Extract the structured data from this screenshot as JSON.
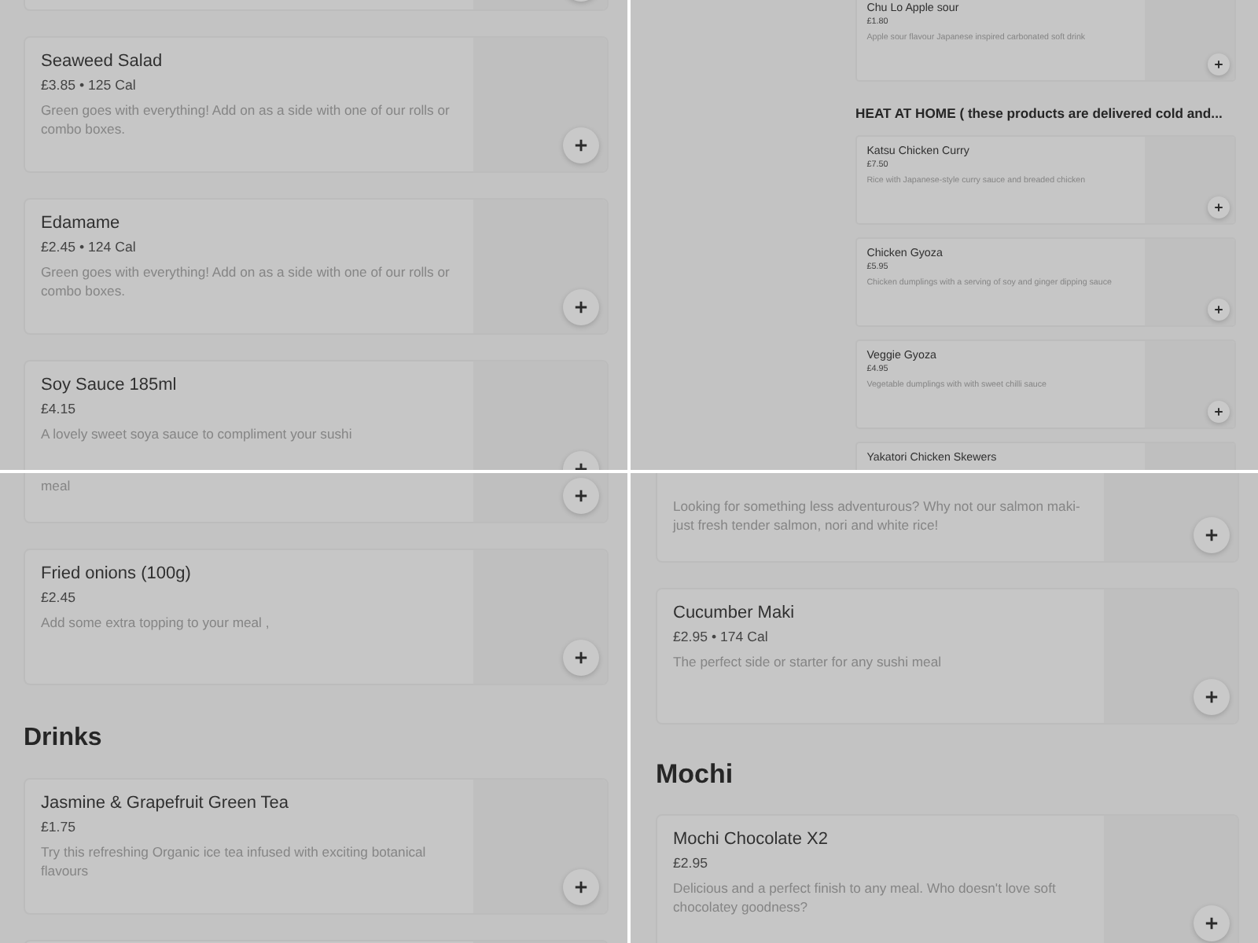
{
  "panels": [
    {
      "entries": [
        {
          "kind": "item_top"
        },
        {
          "kind": "item",
          "name": "Seaweed Salad",
          "price": "£3.85 • 125 Cal",
          "description": "Green goes with everything! Add on as a side with one of our rolls or combo boxes."
        },
        {
          "kind": "item",
          "name": "Edamame",
          "price": "£2.45 • 124 Cal",
          "description": "Green goes with everything! Add on as a side with one of our rolls or combo boxes."
        },
        {
          "kind": "item",
          "name": "Soy Sauce 185ml",
          "price": "£4.15",
          "description": "A lovely sweet soya sauce to compliment your sushi"
        }
      ]
    },
    {
      "entries": [
        {
          "kind": "item",
          "name": "Chu Lo Apple sour",
          "price": "£1.80",
          "description": "Apple sour flavour Japanese inspired carbonated soft drink"
        },
        {
          "kind": "heading",
          "title": "HEAT AT HOME ( these products are delivered cold and..."
        },
        {
          "kind": "item",
          "name": "Katsu Chicken Curry",
          "price": "£7.50",
          "description": "Rice with Japanese-style curry sauce and breaded chicken"
        },
        {
          "kind": "item",
          "name": "Chicken Gyoza",
          "price": "£5.95",
          "description": "Chicken dumplings with a serving of soy and ginger dipping sauce"
        },
        {
          "kind": "item",
          "name": "Veggie Gyoza",
          "price": "£4.95",
          "description": "Vegetable dumplings with with sweet chilli sauce"
        },
        {
          "kind": "item_cut",
          "name": "Yakatori Chicken Skewers"
        }
      ]
    },
    {
      "entries": [
        {
          "kind": "item",
          "description": "meal"
        },
        {
          "kind": "item",
          "name": "Fried onions (100g)",
          "price": "£2.45",
          "description": "Add some extra topping to your meal ,"
        },
        {
          "kind": "heading",
          "title": "Drinks"
        },
        {
          "kind": "item",
          "name": "Jasmine & Grapefruit Green Tea",
          "price": "£1.75",
          "description": "Try this refreshing Organic ice tea infused with exciting botanical flavours"
        },
        {
          "kind": "item_cut"
        }
      ]
    },
    {
      "entries": [
        {
          "kind": "item",
          "description": "Looking for something less adventurous? Why not our salmon maki- just fresh tender salmon, nori and white rice!"
        },
        {
          "kind": "item",
          "name": "Cucumber Maki",
          "price": "£2.95 • 174 Cal",
          "description": "The perfect side or starter for any sushi meal"
        },
        {
          "kind": "heading",
          "title": "Mochi"
        },
        {
          "kind": "item",
          "name": "Mochi Chocolate X2",
          "price": "£2.95",
          "description": "Delicious and a perfect finish to any meal. Who doesn't love soft chocolatey goodness?"
        }
      ]
    }
  ]
}
